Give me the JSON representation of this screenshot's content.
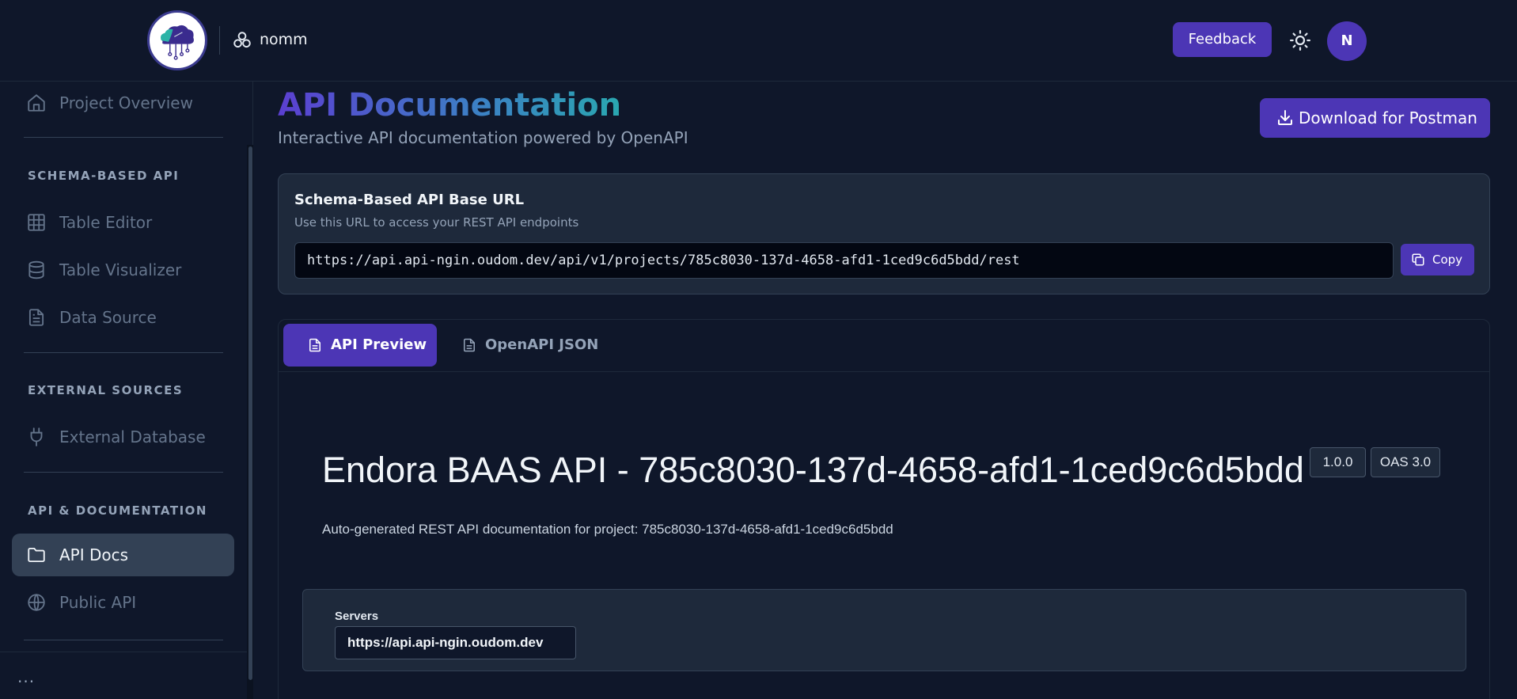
{
  "header": {
    "org_name": "nomm",
    "feedback_label": "Feedback",
    "avatar_initial": "N",
    "theme_icon": "sun-icon",
    "logo_icon": "cloud-logo-icon"
  },
  "sidebar": {
    "items": [
      {
        "label": "Project Overview",
        "icon": "home-icon"
      },
      {
        "label": "Table Editor",
        "icon": "table-grid-icon"
      },
      {
        "label": "Table Visualizer",
        "icon": "database-icon"
      },
      {
        "label": "Data Source",
        "icon": "file-text-icon"
      },
      {
        "label": "External Database",
        "icon": "plug-icon"
      },
      {
        "label": "API Docs",
        "icon": "folder-icon",
        "active": true
      },
      {
        "label": "Public API",
        "icon": "globe-icon"
      }
    ],
    "sections": {
      "schema": "SCHEMA-BASED API",
      "external": "EXTERNAL SOURCES",
      "api_docs": "API & DOCUMENTATION"
    },
    "more_label": "..."
  },
  "main": {
    "title": "API Documentation",
    "subtitle": "Interactive API documentation powered by OpenAPI",
    "download_label": "Download for Postman",
    "base_url_card": {
      "title": "Schema-Based API Base URL",
      "description": "Use this URL to access your REST API endpoints",
      "url": "https://api.api-ngin.oudom.dev/api/v1/projects/785c8030-137d-4658-afd1-1ced9c6d5bdd/rest",
      "copy_label": "Copy"
    },
    "tabs": [
      {
        "label": "API Preview",
        "active": true
      },
      {
        "label": "OpenAPI JSON",
        "active": false
      }
    ],
    "swagger": {
      "title": "Endora BAAS API - 785c8030-137d-4658-afd1-1ced9c6d5bdd",
      "version": "1.0.0",
      "oas": "OAS 3.0",
      "description": "Auto-generated REST API documentation for project: 785c8030-137d-4658-afd1-1ced9c6d5bdd",
      "servers_label": "Servers",
      "server_url": "https://api.api-ngin.oudom.dev"
    }
  },
  "colors": {
    "background": "#0f172a",
    "accent": "#4c36b5",
    "card": "#1e293b",
    "muted_text": "#64748b"
  }
}
